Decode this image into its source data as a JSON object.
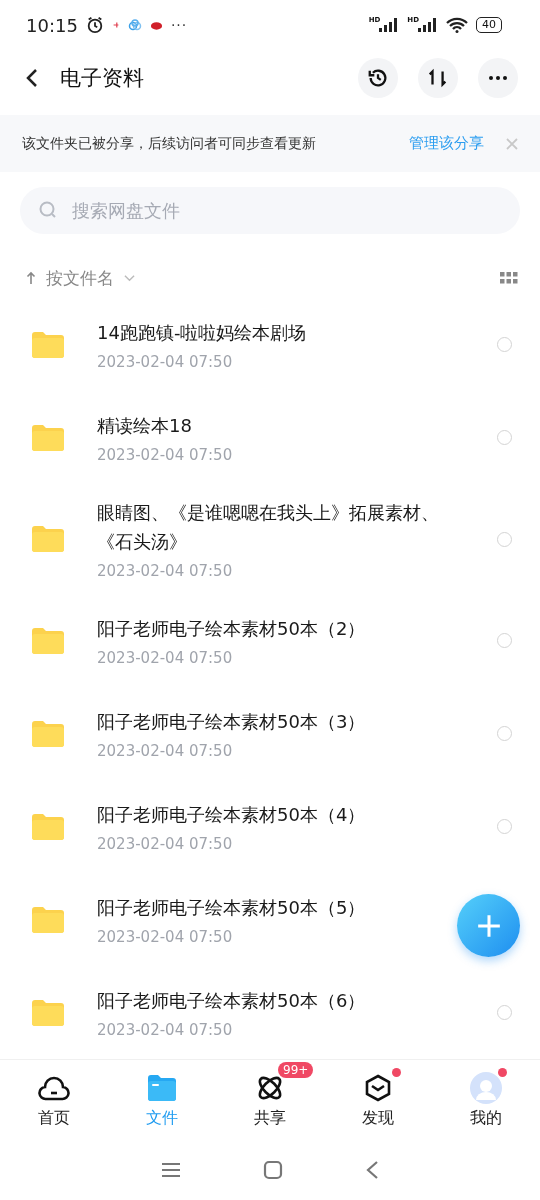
{
  "status_bar": {
    "time": "10:15",
    "more": "···",
    "signal_labels": [
      "HD",
      "HD"
    ],
    "battery": "40"
  },
  "header": {
    "title": "电子资料"
  },
  "banner": {
    "text": "该文件夹已被分享，后续访问者可同步查看更新",
    "link": "管理该分享"
  },
  "search": {
    "placeholder": "搜索网盘文件"
  },
  "sort": {
    "label": "按文件名"
  },
  "files": [
    {
      "name": "14跑跑镇-啦啦妈绘本剧场",
      "date": "2023-02-04  07:50",
      "selected": false
    },
    {
      "name": "精读绘本18",
      "date": "2023-02-04  07:50",
      "selected": false
    },
    {
      "name": "眼睛图、《是谁嗯嗯在我头上》拓展素材、《石头汤》",
      "date": "2023-02-04  07:50",
      "selected": false
    },
    {
      "name": "阳子老师电子绘本素材50本（2）",
      "date": "2023-02-04  07:50",
      "selected": false
    },
    {
      "name": "阳子老师电子绘本素材50本（3）",
      "date": "2023-02-04  07:50",
      "selected": false
    },
    {
      "name": "阳子老师电子绘本素材50本（4）",
      "date": "2023-02-04  07:50",
      "selected": false
    },
    {
      "name": "阳子老师电子绘本素材50本（5）",
      "date": "2023-02-04  07:50",
      "selected": false,
      "radio_hidden": true
    },
    {
      "name": "阳子老师电子绘本素材50本（6）",
      "date": "2023-02-04  07:50",
      "selected": false
    }
  ],
  "tabs": [
    {
      "label": "首页",
      "kind": "home",
      "selected": false,
      "dot": false
    },
    {
      "label": "文件",
      "kind": "files",
      "selected": true,
      "dot": false
    },
    {
      "label": "共享",
      "kind": "share",
      "selected": false,
      "dot": false,
      "badge": "99+"
    },
    {
      "label": "发现",
      "kind": "discover",
      "selected": false,
      "dot": true
    },
    {
      "label": "我的",
      "kind": "me",
      "selected": false,
      "dot": true
    }
  ]
}
